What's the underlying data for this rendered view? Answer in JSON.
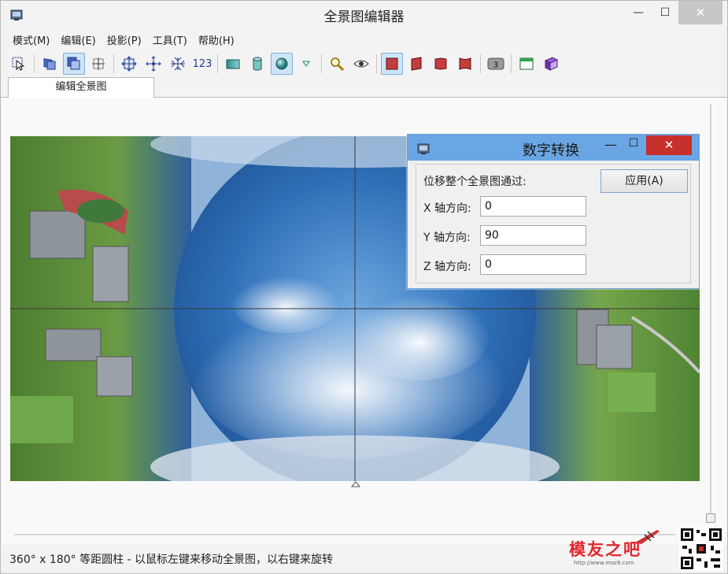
{
  "window": {
    "title": "全景图编辑器",
    "min_symbol": "—",
    "max_symbol": "☐",
    "close_symbol": "✕"
  },
  "menu": [
    {
      "label": "模式(M)"
    },
    {
      "label": "编辑(E)"
    },
    {
      "label": "投影(P)"
    },
    {
      "label": "工具(T)"
    },
    {
      "label": "帮助(H)"
    }
  ],
  "toolbar": {
    "number_button_label": "123",
    "badge_label": "3",
    "buttons": [
      "select-pointer-icon",
      "rotate-view-icon",
      "move-view-icon",
      "grid-lines-icon",
      "expand-arrows-icon",
      "move-center-icon",
      "compress-arrows-icon",
      "number-input-icon",
      "rectangle-projection-icon",
      "cylinder-projection-icon",
      "sphere-projection-icon",
      "dropdown-arrow-icon",
      "zoom-icon",
      "preview-eye-icon",
      "plane-face-1-icon",
      "plane-face-2-icon",
      "plane-face-3-icon",
      "plane-face-4-icon",
      "layer-badge-icon",
      "window-icon",
      "book-icon"
    ]
  },
  "tabs": [
    {
      "label": "编辑全景图"
    }
  ],
  "status": {
    "text": "360° x 180° 等距圆柱 - 以鼠标左键来移动全景图，以右键来旋转"
  },
  "watermark": {
    "text": "模友之吧",
    "url": "http://www.moz8.com"
  },
  "dialog": {
    "title": "数字转换",
    "min_symbol": "—",
    "max_symbol": "☐",
    "close_symbol": "✕",
    "intro": "位移整个全景图通过:",
    "apply_label": "应用(A)",
    "fields": [
      {
        "label": "X 轴方向:",
        "value": "0"
      },
      {
        "label": "Y 轴方向:",
        "value": "90"
      },
      {
        "label": "Z 轴方向:",
        "value": "0"
      }
    ]
  },
  "colors": {
    "dialog_title_bg": "#6ba6e4",
    "close_button": "#c7302a",
    "sky": "#2e6fb8",
    "cloud": "#e8eef5",
    "grass": "#5f8f3a",
    "track": "#b84b4b"
  }
}
